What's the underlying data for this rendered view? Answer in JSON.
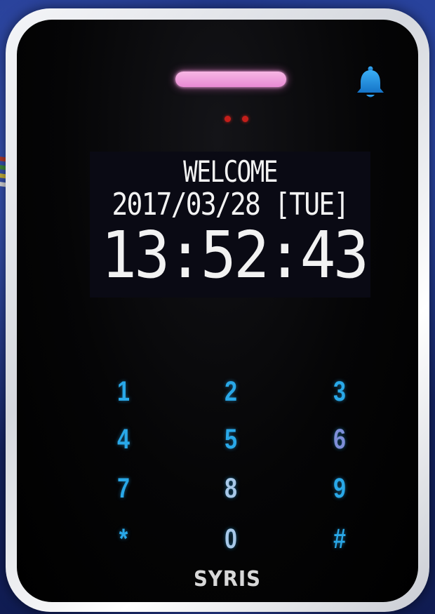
{
  "screen": {
    "line1": "WELCOME",
    "date": "2017/03/28",
    "weekday": "[TUE]",
    "time": "13:52:43"
  },
  "keypad": {
    "keys": [
      "1",
      "2",
      "3",
      "4",
      "5",
      "6",
      "7",
      "8",
      "9",
      "*",
      "0",
      "#"
    ]
  },
  "brand": {
    "logo": "SYRIS"
  },
  "indicators": {
    "light_bar_color": "#ef9ad9",
    "sensor_color": "#c41e1a",
    "key_color": "#29a8e8",
    "bell_color": "#1e8ee0"
  },
  "icons": {
    "bell": "bell-icon"
  }
}
